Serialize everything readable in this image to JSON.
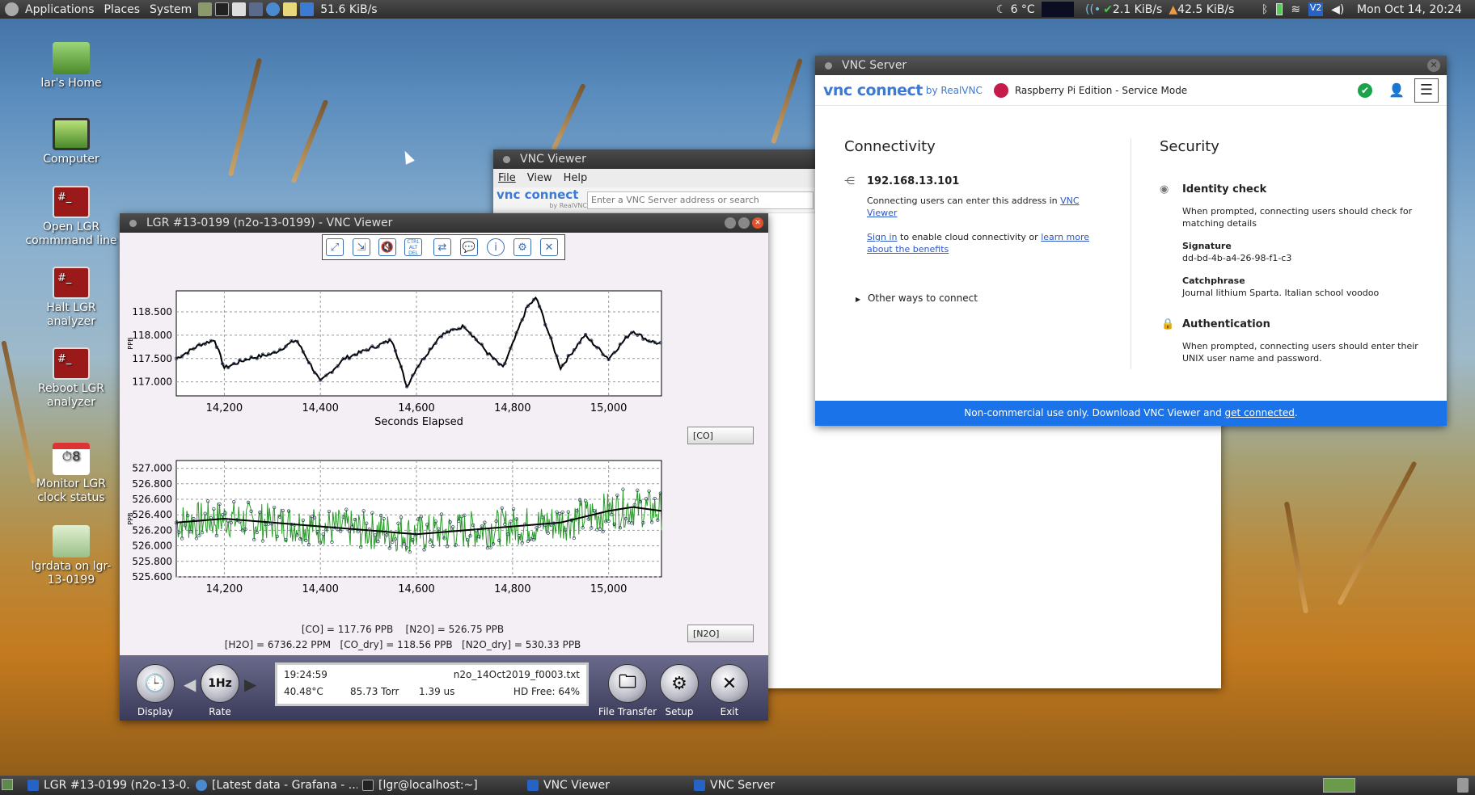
{
  "topbar": {
    "applications": "Applications",
    "places": "Places",
    "system": "System",
    "netspeed": "51.6 KiB/s",
    "weather": "6 °C",
    "down": "2.1 KiB/s",
    "up": "42.5 KiB/s",
    "clock": "Mon Oct 14, 20:24"
  },
  "desktop": [
    {
      "label": "lar's Home",
      "icon": "home-folder-icon"
    },
    {
      "label": "Computer",
      "icon": "computer-icon"
    },
    {
      "label": "Open LGR commmand line",
      "icon": "terminal-icon"
    },
    {
      "label": "Halt LGR analyzer",
      "icon": "terminal-icon"
    },
    {
      "label": "Reboot LGR analyzer",
      "icon": "terminal-icon"
    },
    {
      "label": "Monitor LGR clock status",
      "icon": "calendar-clock-icon"
    },
    {
      "label": "lgrdata on lgr-13-0199",
      "icon": "network-folder-icon"
    }
  ],
  "vncviewer": {
    "title": "VNC Viewer",
    "menu": [
      "File",
      "View",
      "Help"
    ],
    "logo": "vnc connect",
    "logo_sub": "by RealVNC",
    "search_placeholder": "Enter a VNC Server address or search"
  },
  "lgr": {
    "title": "LGR #13-0199 (n2o-13-0199) - VNC Viewer",
    "toolbar": [
      "fullscreen-icon",
      "scale-icon",
      "mute-icon",
      "ctrl-alt-del-icon",
      "transfer-icon",
      "chat-icon",
      "info-icon",
      "settings-icon",
      "close-icon"
    ],
    "ctrlaltdel": "CTRL ALT DEL",
    "chart1": {
      "ylabel": "PPB",
      "xlabel": "Seconds Elapsed",
      "select": "[CO]"
    },
    "chart2": {
      "ylabel": "PPB",
      "select": "[N2O]"
    },
    "readout1": "[CO] = 117.76 PPB    [N2O] = 526.75 PPB",
    "readout2": "[H2O] = 6736.22 PPM   [CO_dry] = 118.56 PPB   [N2O_dry] = 530.33 PPB",
    "status": {
      "time": "19:24:59",
      "file": "n2o_14Oct2019_f0003.txt",
      "temp": "40.48°C",
      "pressure": "85.73 Torr",
      "tau": "1.39 us",
      "hd": "HD Free: 64%"
    },
    "controls": {
      "display": "Display",
      "rate": "Rate",
      "rate_value": "1Hz",
      "file": "File Transfer",
      "setup": "Setup",
      "exit": "Exit"
    }
  },
  "chart_data": [
    {
      "type": "line",
      "ylabel": "PPB",
      "xlabel": "Seconds Elapsed",
      "xlim": [
        14100,
        15110
      ],
      "ylim": [
        116.7,
        118.95
      ],
      "x_ticks": [
        "14,200",
        "14,400",
        "14,600",
        "14,800",
        "15,000"
      ],
      "y_ticks": [
        "118.500",
        "118.000",
        "117.500",
        "117.000"
      ],
      "series": [
        {
          "x": [
            14100,
            14150,
            14180,
            14200,
            14250,
            14300,
            14350,
            14400,
            14450,
            14500,
            14550,
            14580,
            14600,
            14650,
            14700,
            14750,
            14780,
            14800,
            14830,
            14850,
            14880,
            14900,
            14950,
            15000,
            15050,
            15080,
            15110
          ],
          "y": [
            117.5,
            117.8,
            117.9,
            117.3,
            117.5,
            117.6,
            117.9,
            117.0,
            117.5,
            117.7,
            117.9,
            116.9,
            117.3,
            118.0,
            118.2,
            117.6,
            117.3,
            117.8,
            118.6,
            118.8,
            117.9,
            117.3,
            118.0,
            117.5,
            118.1,
            117.9,
            117.8
          ]
        }
      ]
    },
    {
      "type": "line",
      "ylabel": "PPB",
      "xlim": [
        14100,
        15110
      ],
      "ylim": [
        525.6,
        527.1
      ],
      "x_ticks": [
        "14,200",
        "14,400",
        "14,600",
        "14,800",
        "15,000"
      ],
      "y_ticks": [
        "527.000",
        "526.800",
        "526.600",
        "526.400",
        "526.200",
        "526.000",
        "525.800",
        "525.600"
      ],
      "series": [
        {
          "x": [
            14100,
            14200,
            14300,
            14400,
            14500,
            14600,
            14700,
            14800,
            14900,
            15000,
            15050,
            15110
          ],
          "y": [
            526.3,
            526.35,
            526.3,
            526.25,
            526.2,
            526.15,
            526.2,
            526.25,
            526.3,
            526.45,
            526.5,
            526.45
          ]
        }
      ]
    }
  ],
  "vncserver": {
    "title": "VNC Server",
    "logo": "vnc connect",
    "logo_by": "by RealVNC",
    "edition": "Raspberry Pi Edition - Service Mode",
    "conn_title": "Connectivity",
    "ip": "192.168.13.101",
    "conn_text": "Connecting users can enter this address in",
    "conn_link": "VNC Viewer",
    "sign_in": "Sign in",
    "sign_text": "to enable cloud connectivity or",
    "learn": "learn more about the benefits",
    "other": "Other ways to connect",
    "sec_title": "Security",
    "id_title": "Identity check",
    "id_text": "When prompted, connecting users should check for matching details",
    "sig_label": "Signature",
    "sig": "dd-bd-4b-a4-26-98-f1-c3",
    "catch_label": "Catchphrase",
    "catch": "Journal lithium Sparta. Italian school voodoo",
    "auth_title": "Authentication",
    "auth_text": "When prompted, connecting users should enter their UNIX user name and password.",
    "footer": "Non-commercial use only. Download VNC Viewer and",
    "footer_link": "get connected",
    "footer_end": "."
  },
  "taskbar": [
    {
      "label": "LGR #13-0199 (n2o-13-0..."
    },
    {
      "label": "[Latest data - Grafana - ..."
    },
    {
      "label": "[lgr@localhost:~]"
    },
    {
      "label": "VNC Viewer"
    },
    {
      "label": "VNC Server"
    }
  ],
  "colors": {
    "accent": "#1a73e8",
    "plot_bg": "#f4eff5",
    "green": "#2a9a2a",
    "panel": "#4a4a6a"
  }
}
